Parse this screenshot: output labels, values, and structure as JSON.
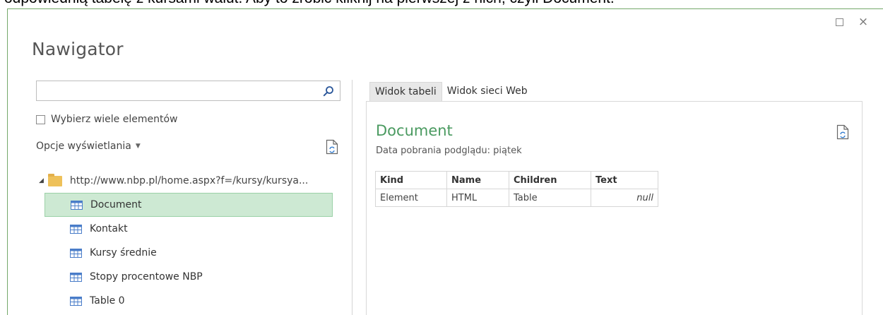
{
  "caption": "odpowiednią tabelę z kursami walut. Aby to zrobić kliknij na pierwszej z nich, czyli Document.",
  "dialog": {
    "title": "Nawigator",
    "close_glyph": "×"
  },
  "search": {
    "placeholder": "",
    "value": ""
  },
  "multi_select_label": "Wybierz wiele elementów",
  "display_options_label": "Opcje wyświetlania",
  "tree": {
    "root_label": "http://www.nbp.pl/home.aspx?f=/kursy/kursya...",
    "items": [
      {
        "label": "Document",
        "selected": true
      },
      {
        "label": "Kontakt"
      },
      {
        "label": "Kursy średnie"
      },
      {
        "label": "Stopy procentowe NBP"
      },
      {
        "label": "Table 0"
      }
    ]
  },
  "tabs": [
    {
      "label": "Widok tabeli",
      "active": true
    },
    {
      "label": "Widok sieci Web"
    }
  ],
  "preview": {
    "title": "Document",
    "subtitle": "Data pobrania podglądu: piątek",
    "columns": [
      "Kind",
      "Name",
      "Children",
      "Text"
    ],
    "rows": [
      [
        "Element",
        "HTML",
        "Table",
        "null"
      ]
    ]
  },
  "colors": {
    "accent_green": "#4a9a60",
    "selection_bg": "#cde9d3",
    "folder": "#eec15a"
  },
  "icons": [
    "search-icon",
    "refresh-icon",
    "folder-icon",
    "table-icon",
    "maximize-icon",
    "close-icon",
    "expand-arrow-icon",
    "dropdown-caret-icon"
  ]
}
